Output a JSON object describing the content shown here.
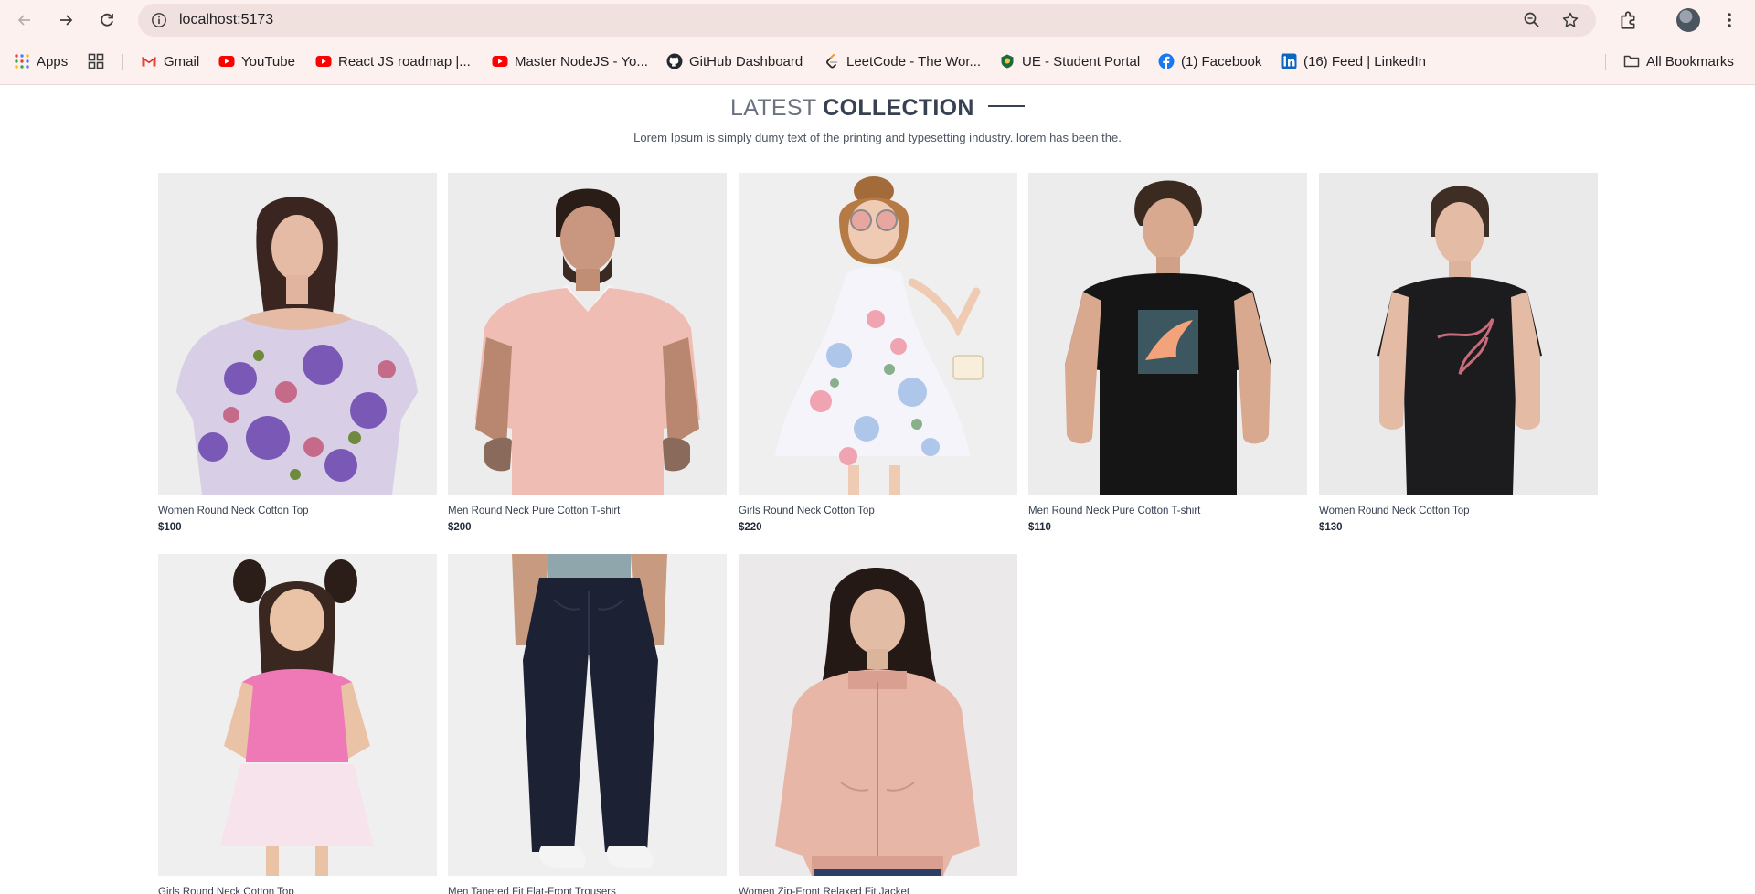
{
  "browser": {
    "url": "localhost:5173",
    "bookmarks": [
      {
        "label": "Apps",
        "icon": "apps-grid-icon"
      },
      {
        "label": "Gmail",
        "icon": "gmail-icon"
      },
      {
        "label": "YouTube",
        "icon": "youtube-icon"
      },
      {
        "label": "React JS roadmap |...",
        "icon": "youtube-icon"
      },
      {
        "label": "Master NodeJS - Yo...",
        "icon": "youtube-icon"
      },
      {
        "label": "GitHub Dashboard",
        "icon": "github-icon"
      },
      {
        "label": "LeetCode - The Wor...",
        "icon": "leetcode-icon"
      },
      {
        "label": "UE - Student Portal",
        "icon": "ue-portal-icon"
      },
      {
        "label": "(1) Facebook",
        "icon": "facebook-icon"
      },
      {
        "label": "(16) Feed | LinkedIn",
        "icon": "linkedin-icon"
      }
    ],
    "all_bookmarks_label": "All Bookmarks"
  },
  "section": {
    "title_light": "LATEST",
    "title_bold": "COLLECTION",
    "subtitle": "Lorem Ipsum is simply dumy text of the printing and typesetting industry. lorem has been the."
  },
  "products": [
    {
      "name": "Women Round Neck Cotton Top",
      "price": "$100"
    },
    {
      "name": "Men Round Neck Pure Cotton T-shirt",
      "price": "$200"
    },
    {
      "name": "Girls Round Neck Cotton Top",
      "price": "$220"
    },
    {
      "name": "Men Round Neck Pure Cotton T-shirt",
      "price": "$110"
    },
    {
      "name": "Women Round Neck Cotton Top",
      "price": "$130"
    },
    {
      "name": "Girls Round Neck Cotton Top",
      "price": ""
    },
    {
      "name": "Men Tapered Fit Flat-Front Trousers",
      "price": ""
    },
    {
      "name": "Women Zip-Front Relaxed Fit Jacket",
      "price": ""
    }
  ]
}
